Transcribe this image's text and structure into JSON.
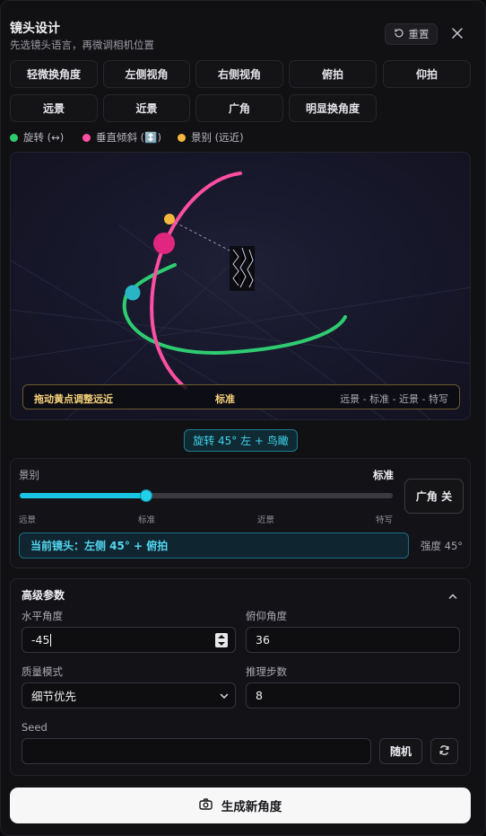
{
  "header": {
    "title": "镜头设计",
    "subtitle": "先选镜头语言，再微调相机位置",
    "reset_label": "重置"
  },
  "presets": {
    "row1": [
      "轻微换角度",
      "左侧视角",
      "右侧视角",
      "俯拍",
      "仰拍"
    ],
    "row2": [
      "远景",
      "近景",
      "广角",
      "明显换角度"
    ]
  },
  "legend": {
    "rotate": "旋转 (↔)",
    "tilt": "垂直倾斜 (↕️)",
    "distance": "景别 (远近)"
  },
  "viewport": {
    "hint": "拖动黄点调整远近",
    "center": "标准",
    "scale": "远景 - 标准 - 近景 - 特写"
  },
  "status_badge": "旋转 45° 左 + 鸟瞰",
  "shot": {
    "label": "景别",
    "value": "标准",
    "slider_fraction": 0.34,
    "ticks": [
      "远景",
      "标准",
      "近景",
      "特写"
    ],
    "wide_button": "广角 关",
    "current": "当前镜头：左侧 45° + 俯拍",
    "strength": "强度 45°"
  },
  "advanced": {
    "title": "高级参数",
    "horizontal_label": "水平角度",
    "horizontal_value": "-45",
    "pitch_label": "俯仰角度",
    "pitch_value": "36",
    "quality_label": "质量模式",
    "quality_value": "细节优先",
    "steps_label": "推理步数",
    "steps_value": "8",
    "seed_label": "Seed",
    "seed_value": "",
    "random_label": "随机"
  },
  "generate_label": "生成新角度",
  "colors": {
    "rotate": "#2ecc71",
    "tilt": "#ff4fa3",
    "distance": "#f5b83d",
    "accent": "#18c6e3"
  }
}
